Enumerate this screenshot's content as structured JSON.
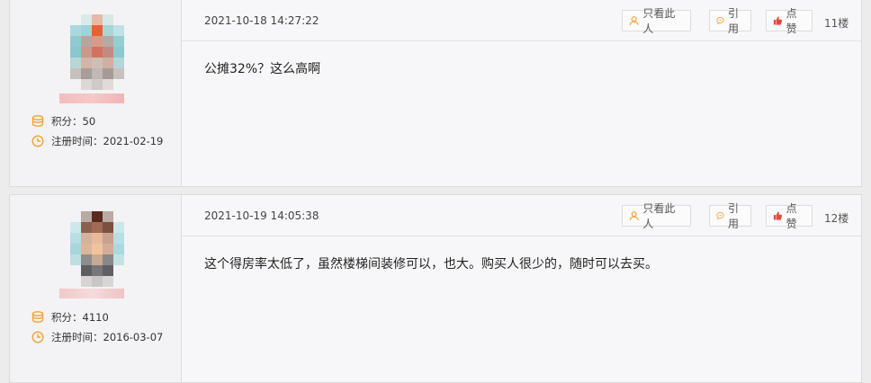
{
  "posts": [
    {
      "points_label": "积分：",
      "points": "50",
      "reg_label": "注册时间：",
      "reg_date": "2021-02-19",
      "time": "2021-10-18 14:27:22",
      "btn_only": "只看此人",
      "btn_quote": "引用",
      "btn_like": "点赞",
      "floor": "11楼",
      "text": "公摊32%？这么高啊"
    },
    {
      "points_label": "积分：",
      "points": "4110",
      "reg_label": "注册时间：",
      "reg_date": "2016-03-07",
      "time": "2021-10-19 14:05:38",
      "btn_only": "只看此人",
      "btn_quote": "引用",
      "btn_like": "点赞",
      "floor": "12楼",
      "text": "这个得房率太低了，虽然楼梯间装修可以，也大。购买人很少的，随时可以去买。"
    }
  ],
  "colors": {
    "icon_orange": "#f2a23a",
    "like_red": "#e6483f"
  }
}
